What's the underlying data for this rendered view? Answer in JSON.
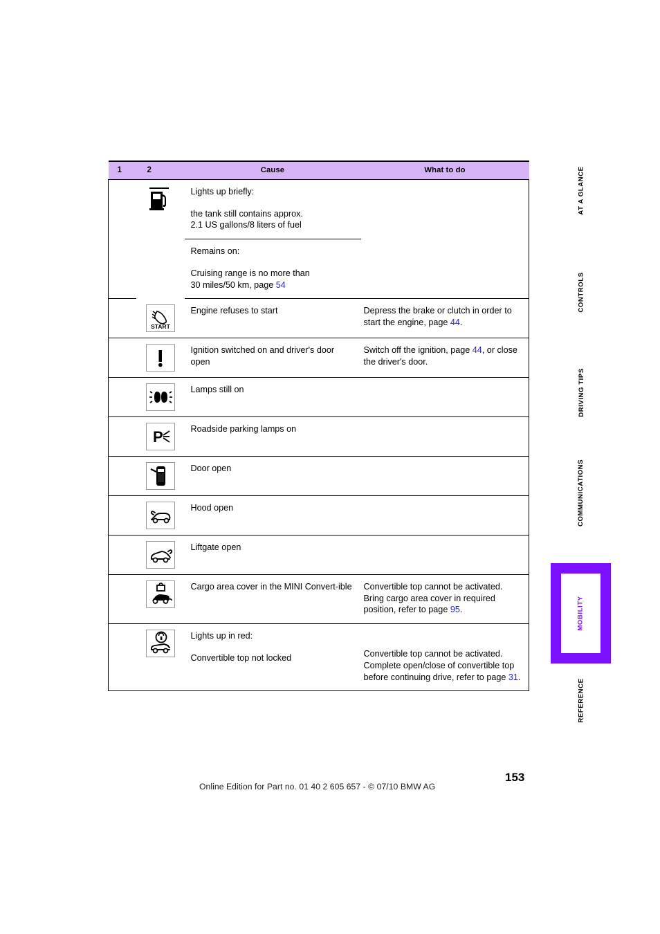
{
  "document": {
    "page_number": "153",
    "footer_text": "Online Edition for Part no. 01 40 2 605 657 - © 07/10  BMW AG",
    "accent_color": "#7b0fff",
    "header_bg_color": "#d6b4f5",
    "link_color": "#2323d6"
  },
  "table": {
    "headers": {
      "col1": "1",
      "col2": "2",
      "col3": "Cause",
      "col4": "What to do"
    },
    "rows": [
      {
        "icon": "fuel-pump-icon",
        "cause_line1": "Lights up briefly:",
        "cause_line2": "the tank still contains approx.",
        "cause_line3": "2.1 US gallons/8 liters of fuel",
        "todo": "",
        "sub": {
          "cause_line1": "Remains on:",
          "cause_line2": "Cruising range is no more than",
          "cause_line3_pre": "30 miles/50 km, page ",
          "cause_line3_ref": "54",
          "cause_line3_post": "",
          "todo": ""
        }
      },
      {
        "icon": "start-hand-icon",
        "icon_label": "START",
        "cause_line1": "Engine refuses to start",
        "todo_pre": "Depress the brake or clutch in order to start the engine, page ",
        "todo_ref": "44",
        "todo_post": "."
      },
      {
        "icon": "exclamation-icon",
        "cause_line1": "Ignition switched on and driver's door open",
        "todo_pre": "Switch off the ignition, page ",
        "todo_ref": "44",
        "todo_post": ", or close the driver's door."
      },
      {
        "icon": "headlamps-on-icon",
        "cause_line1": "Lamps still on",
        "todo_pre": "",
        "todo_ref": "",
        "todo_post": ""
      },
      {
        "icon": "parking-lamp-icon",
        "cause_line1": "Roadside parking lamps on",
        "todo_pre": "",
        "todo_ref": "",
        "todo_post": ""
      },
      {
        "icon": "door-open-icon",
        "cause_line1": "Door open",
        "todo_pre": "",
        "todo_ref": "",
        "todo_post": ""
      },
      {
        "icon": "hood-open-icon",
        "cause_line1": "Hood open",
        "todo_pre": "",
        "todo_ref": "",
        "todo_post": ""
      },
      {
        "icon": "liftgate-open-icon",
        "cause_line1": "Liftgate open",
        "todo_pre": "",
        "todo_ref": "",
        "todo_post": ""
      },
      {
        "icon": "cargo-cover-icon",
        "cause_line1": "Cargo area cover in the MINI Convert-ible",
        "todo_pre": "Convertible top cannot be activated. Bring cargo area cover in required position, refer to page ",
        "todo_ref": "95",
        "todo_post": "."
      },
      {
        "icon": "convertible-lock-icon",
        "cause_line1": "Lights up in red:",
        "cause_line2": "Convertible top not locked",
        "todo_pre": "Convertible top cannot be activated. Complete open/close of convertible top before continuing drive, refer to page ",
        "todo_ref": "31",
        "todo_post": "."
      }
    ]
  },
  "side_tabs": [
    {
      "label": "AT A GLANCE",
      "active": false
    },
    {
      "label": "CONTROLS",
      "active": false
    },
    {
      "label": "DRIVING TIPS",
      "active": false
    },
    {
      "label": "COMMUNICATIONS",
      "active": false
    },
    {
      "label": "MOBILITY",
      "active": true
    },
    {
      "label": "REFERENCE",
      "active": false
    }
  ]
}
